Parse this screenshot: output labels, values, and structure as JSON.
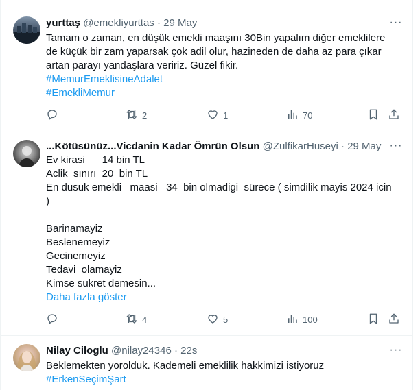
{
  "colors": {
    "accent": "#1d9bf0",
    "muted": "#536471",
    "text": "#0f1419",
    "divider": "#eff3f4"
  },
  "tweets": [
    {
      "name": "yurttaş",
      "handle": "@emekliyurttas",
      "separator": "·",
      "time": "29 May",
      "more": "···",
      "lines": [
        "Tamam o zaman, en düşük emekli maaşını 30Bin yapalım diğer emeklilere",
        "de küçük bir zam yaparsak çok adil olur, hazineden de daha az para çıkar",
        "artan parayı yandaşlara veririz. Güzel fikir."
      ],
      "hashtags": [
        "#MemurEmeklisineAdalet",
        "#EmekliMemur"
      ],
      "replies": "",
      "reposts": "2",
      "likes": "1",
      "views": "70",
      "icons": [
        "reply-icon",
        "repost-icon",
        "like-icon",
        "views-icon",
        "bookmark-icon",
        "share-icon"
      ]
    },
    {
      "name": "...Kötüsünüz...Vicdanin Kadar Ömrün Olsun",
      "handle": "@ZulfikarHuseyi",
      "separator": "·",
      "time": "29 May",
      "more": "···",
      "lines": [
        "Ev kirasi      14 bin TL",
        "Aclik  sınırı  20  bin TL",
        "En dusuk emekli   maasi   34  bin olmadigi  sürece ( simdilik mayis 2024 icin",
        ")",
        "",
        "Barinamayiz",
        "Beslenemeyiz",
        "Gecinemeyiz",
        "Tedavi  olamayiz",
        "Kimse sukret demesin..."
      ],
      "show_more": "Daha fazla göster",
      "replies": "",
      "reposts": "4",
      "likes": "5",
      "views": "100"
    },
    {
      "name": "Nilay Ciloglu",
      "handle": "@nilay24346",
      "separator": "·",
      "time": "22s",
      "more": "···",
      "lines": [
        "Beklemekten yorolduk. Kademeli emeklilik hakkimizi istiyoruz"
      ],
      "hashtags": [
        "#ErkenSeçimŞart"
      ]
    }
  ]
}
